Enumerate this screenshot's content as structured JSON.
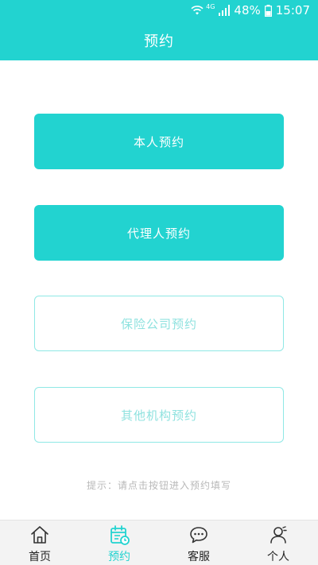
{
  "status_bar": {
    "network": "4G",
    "battery": "48%",
    "time": "15:07"
  },
  "header": {
    "title": "预约"
  },
  "buttons": {
    "self": "本人预约",
    "agent": "代理人预约",
    "insurer": "保险公司预约",
    "other": "其他机构预约"
  },
  "hint": "提示：请点击按钮进入预约填写",
  "tabs": [
    {
      "label": "首页",
      "icon": "home-icon",
      "active": false
    },
    {
      "label": "预约",
      "icon": "calendar-icon",
      "active": true
    },
    {
      "label": "客服",
      "icon": "chat-icon",
      "active": false
    },
    {
      "label": "个人",
      "icon": "user-icon",
      "active": false
    }
  ],
  "colors": {
    "accent": "#22d3d0",
    "outline_border": "#8fe8e5",
    "outline_text": "#8fe2df",
    "tabbar_bg": "#f3f3f3"
  }
}
